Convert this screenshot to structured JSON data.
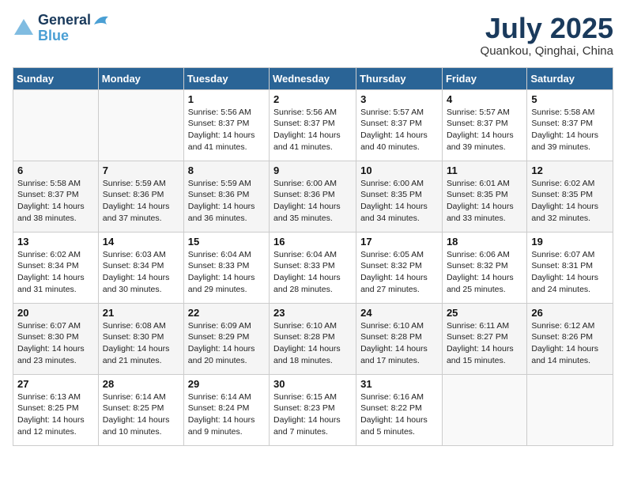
{
  "header": {
    "logo_line1": "General",
    "logo_line2": "Blue",
    "month": "July 2025",
    "location": "Quankou, Qinghai, China"
  },
  "weekdays": [
    "Sunday",
    "Monday",
    "Tuesday",
    "Wednesday",
    "Thursday",
    "Friday",
    "Saturday"
  ],
  "weeks": [
    [
      {
        "day": "",
        "sunrise": "",
        "sunset": "",
        "daylight": ""
      },
      {
        "day": "",
        "sunrise": "",
        "sunset": "",
        "daylight": ""
      },
      {
        "day": "1",
        "sunrise": "Sunrise: 5:56 AM",
        "sunset": "Sunset: 8:37 PM",
        "daylight": "Daylight: 14 hours and 41 minutes."
      },
      {
        "day": "2",
        "sunrise": "Sunrise: 5:56 AM",
        "sunset": "Sunset: 8:37 PM",
        "daylight": "Daylight: 14 hours and 41 minutes."
      },
      {
        "day": "3",
        "sunrise": "Sunrise: 5:57 AM",
        "sunset": "Sunset: 8:37 PM",
        "daylight": "Daylight: 14 hours and 40 minutes."
      },
      {
        "day": "4",
        "sunrise": "Sunrise: 5:57 AM",
        "sunset": "Sunset: 8:37 PM",
        "daylight": "Daylight: 14 hours and 39 minutes."
      },
      {
        "day": "5",
        "sunrise": "Sunrise: 5:58 AM",
        "sunset": "Sunset: 8:37 PM",
        "daylight": "Daylight: 14 hours and 39 minutes."
      }
    ],
    [
      {
        "day": "6",
        "sunrise": "Sunrise: 5:58 AM",
        "sunset": "Sunset: 8:37 PM",
        "daylight": "Daylight: 14 hours and 38 minutes."
      },
      {
        "day": "7",
        "sunrise": "Sunrise: 5:59 AM",
        "sunset": "Sunset: 8:36 PM",
        "daylight": "Daylight: 14 hours and 37 minutes."
      },
      {
        "day": "8",
        "sunrise": "Sunrise: 5:59 AM",
        "sunset": "Sunset: 8:36 PM",
        "daylight": "Daylight: 14 hours and 36 minutes."
      },
      {
        "day": "9",
        "sunrise": "Sunrise: 6:00 AM",
        "sunset": "Sunset: 8:36 PM",
        "daylight": "Daylight: 14 hours and 35 minutes."
      },
      {
        "day": "10",
        "sunrise": "Sunrise: 6:00 AM",
        "sunset": "Sunset: 8:35 PM",
        "daylight": "Daylight: 14 hours and 34 minutes."
      },
      {
        "day": "11",
        "sunrise": "Sunrise: 6:01 AM",
        "sunset": "Sunset: 8:35 PM",
        "daylight": "Daylight: 14 hours and 33 minutes."
      },
      {
        "day": "12",
        "sunrise": "Sunrise: 6:02 AM",
        "sunset": "Sunset: 8:35 PM",
        "daylight": "Daylight: 14 hours and 32 minutes."
      }
    ],
    [
      {
        "day": "13",
        "sunrise": "Sunrise: 6:02 AM",
        "sunset": "Sunset: 8:34 PM",
        "daylight": "Daylight: 14 hours and 31 minutes."
      },
      {
        "day": "14",
        "sunrise": "Sunrise: 6:03 AM",
        "sunset": "Sunset: 8:34 PM",
        "daylight": "Daylight: 14 hours and 30 minutes."
      },
      {
        "day": "15",
        "sunrise": "Sunrise: 6:04 AM",
        "sunset": "Sunset: 8:33 PM",
        "daylight": "Daylight: 14 hours and 29 minutes."
      },
      {
        "day": "16",
        "sunrise": "Sunrise: 6:04 AM",
        "sunset": "Sunset: 8:33 PM",
        "daylight": "Daylight: 14 hours and 28 minutes."
      },
      {
        "day": "17",
        "sunrise": "Sunrise: 6:05 AM",
        "sunset": "Sunset: 8:32 PM",
        "daylight": "Daylight: 14 hours and 27 minutes."
      },
      {
        "day": "18",
        "sunrise": "Sunrise: 6:06 AM",
        "sunset": "Sunset: 8:32 PM",
        "daylight": "Daylight: 14 hours and 25 minutes."
      },
      {
        "day": "19",
        "sunrise": "Sunrise: 6:07 AM",
        "sunset": "Sunset: 8:31 PM",
        "daylight": "Daylight: 14 hours and 24 minutes."
      }
    ],
    [
      {
        "day": "20",
        "sunrise": "Sunrise: 6:07 AM",
        "sunset": "Sunset: 8:30 PM",
        "daylight": "Daylight: 14 hours and 23 minutes."
      },
      {
        "day": "21",
        "sunrise": "Sunrise: 6:08 AM",
        "sunset": "Sunset: 8:30 PM",
        "daylight": "Daylight: 14 hours and 21 minutes."
      },
      {
        "day": "22",
        "sunrise": "Sunrise: 6:09 AM",
        "sunset": "Sunset: 8:29 PM",
        "daylight": "Daylight: 14 hours and 20 minutes."
      },
      {
        "day": "23",
        "sunrise": "Sunrise: 6:10 AM",
        "sunset": "Sunset: 8:28 PM",
        "daylight": "Daylight: 14 hours and 18 minutes."
      },
      {
        "day": "24",
        "sunrise": "Sunrise: 6:10 AM",
        "sunset": "Sunset: 8:28 PM",
        "daylight": "Daylight: 14 hours and 17 minutes."
      },
      {
        "day": "25",
        "sunrise": "Sunrise: 6:11 AM",
        "sunset": "Sunset: 8:27 PM",
        "daylight": "Daylight: 14 hours and 15 minutes."
      },
      {
        "day": "26",
        "sunrise": "Sunrise: 6:12 AM",
        "sunset": "Sunset: 8:26 PM",
        "daylight": "Daylight: 14 hours and 14 minutes."
      }
    ],
    [
      {
        "day": "27",
        "sunrise": "Sunrise: 6:13 AM",
        "sunset": "Sunset: 8:25 PM",
        "daylight": "Daylight: 14 hours and 12 minutes."
      },
      {
        "day": "28",
        "sunrise": "Sunrise: 6:14 AM",
        "sunset": "Sunset: 8:25 PM",
        "daylight": "Daylight: 14 hours and 10 minutes."
      },
      {
        "day": "29",
        "sunrise": "Sunrise: 6:14 AM",
        "sunset": "Sunset: 8:24 PM",
        "daylight": "Daylight: 14 hours and 9 minutes."
      },
      {
        "day": "30",
        "sunrise": "Sunrise: 6:15 AM",
        "sunset": "Sunset: 8:23 PM",
        "daylight": "Daylight: 14 hours and 7 minutes."
      },
      {
        "day": "31",
        "sunrise": "Sunrise: 6:16 AM",
        "sunset": "Sunset: 8:22 PM",
        "daylight": "Daylight: 14 hours and 5 minutes."
      },
      {
        "day": "",
        "sunrise": "",
        "sunset": "",
        "daylight": ""
      },
      {
        "day": "",
        "sunrise": "",
        "sunset": "",
        "daylight": ""
      }
    ]
  ]
}
